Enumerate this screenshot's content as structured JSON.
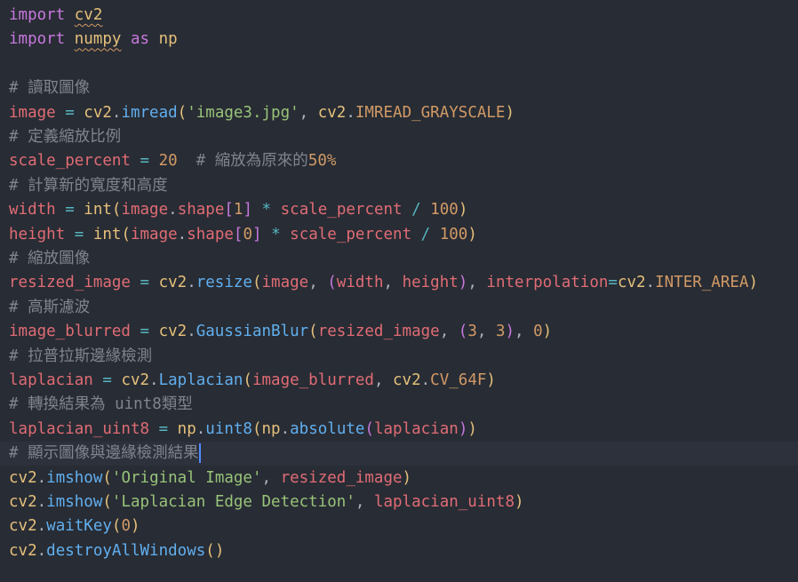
{
  "colors": {
    "background": "#282c34",
    "active_line": "#2c313c",
    "keyword": "#c678dd",
    "module": "#e5c07b",
    "variable": "#e06c75",
    "function": "#61afef",
    "string": "#98c379",
    "number": "#d19a66",
    "operator": "#56b6c2",
    "comment": "#7f848e",
    "punct": "#abb2bf",
    "cursor": "#528bff"
  },
  "editor": {
    "active_line_index": 18,
    "cursor_after_token": 0,
    "lines": [
      [
        {
          "t": "import",
          "c": "keyword"
        },
        {
          "t": " ",
          "c": "punct"
        },
        {
          "t": "cv2",
          "c": "module",
          "squiggle": true
        }
      ],
      [
        {
          "t": "import",
          "c": "keyword"
        },
        {
          "t": " ",
          "c": "punct"
        },
        {
          "t": "numpy",
          "c": "module",
          "squiggle": true
        },
        {
          "t": " as ",
          "c": "keyword"
        },
        {
          "t": "np",
          "c": "module"
        }
      ],
      [],
      [
        {
          "t": "# 讀取圖像",
          "c": "comment"
        }
      ],
      [
        {
          "t": "image",
          "c": "variable"
        },
        {
          "t": " = ",
          "c": "operator"
        },
        {
          "t": "cv2",
          "c": "module"
        },
        {
          "t": ".",
          "c": "punct"
        },
        {
          "t": "imread",
          "c": "function"
        },
        {
          "t": "(",
          "c": "module"
        },
        {
          "t": "'image3.jpg'",
          "c": "string"
        },
        {
          "t": ", ",
          "c": "punct"
        },
        {
          "t": "cv2",
          "c": "module"
        },
        {
          "t": ".",
          "c": "punct"
        },
        {
          "t": "IMREAD_GRAYSCALE",
          "c": "number"
        },
        {
          "t": ")",
          "c": "module"
        }
      ],
      [
        {
          "t": "# 定義縮放比例",
          "c": "comment"
        }
      ],
      [
        {
          "t": "scale_percent",
          "c": "variable"
        },
        {
          "t": " = ",
          "c": "operator"
        },
        {
          "t": "20",
          "c": "number"
        },
        {
          "t": "  # 縮放為原來的",
          "c": "comment"
        },
        {
          "t": "50%",
          "c": "number"
        }
      ],
      [
        {
          "t": "# 計算新的寬度和高度",
          "c": "comment"
        }
      ],
      [
        {
          "t": "width",
          "c": "variable"
        },
        {
          "t": " = ",
          "c": "operator"
        },
        {
          "t": "int",
          "c": "module"
        },
        {
          "t": "(",
          "c": "module"
        },
        {
          "t": "image",
          "c": "variable"
        },
        {
          "t": ".",
          "c": "punct"
        },
        {
          "t": "shape",
          "c": "variable"
        },
        {
          "t": "[",
          "c": "keyword"
        },
        {
          "t": "1",
          "c": "number"
        },
        {
          "t": "]",
          "c": "keyword"
        },
        {
          "t": " * ",
          "c": "operator"
        },
        {
          "t": "scale_percent",
          "c": "variable"
        },
        {
          "t": " / ",
          "c": "operator"
        },
        {
          "t": "100",
          "c": "number"
        },
        {
          "t": ")",
          "c": "module"
        }
      ],
      [
        {
          "t": "height",
          "c": "variable"
        },
        {
          "t": " = ",
          "c": "operator"
        },
        {
          "t": "int",
          "c": "module"
        },
        {
          "t": "(",
          "c": "module"
        },
        {
          "t": "image",
          "c": "variable"
        },
        {
          "t": ".",
          "c": "punct"
        },
        {
          "t": "shape",
          "c": "variable"
        },
        {
          "t": "[",
          "c": "keyword"
        },
        {
          "t": "0",
          "c": "number"
        },
        {
          "t": "]",
          "c": "keyword"
        },
        {
          "t": " * ",
          "c": "operator"
        },
        {
          "t": "scale_percent",
          "c": "variable"
        },
        {
          "t": " / ",
          "c": "operator"
        },
        {
          "t": "100",
          "c": "number"
        },
        {
          "t": ")",
          "c": "module"
        }
      ],
      [
        {
          "t": "# 縮放圖像",
          "c": "comment"
        }
      ],
      [
        {
          "t": "resized_image",
          "c": "variable"
        },
        {
          "t": " = ",
          "c": "operator"
        },
        {
          "t": "cv2",
          "c": "module"
        },
        {
          "t": ".",
          "c": "punct"
        },
        {
          "t": "resize",
          "c": "function"
        },
        {
          "t": "(",
          "c": "module"
        },
        {
          "t": "image",
          "c": "variable"
        },
        {
          "t": ", ",
          "c": "punct"
        },
        {
          "t": "(",
          "c": "keyword"
        },
        {
          "t": "width",
          "c": "variable"
        },
        {
          "t": ", ",
          "c": "punct"
        },
        {
          "t": "height",
          "c": "variable"
        },
        {
          "t": ")",
          "c": "keyword"
        },
        {
          "t": ", ",
          "c": "punct"
        },
        {
          "t": "interpolation",
          "c": "variable"
        },
        {
          "t": "=",
          "c": "operator"
        },
        {
          "t": "cv2",
          "c": "module"
        },
        {
          "t": ".",
          "c": "punct"
        },
        {
          "t": "INTER_AREA",
          "c": "number"
        },
        {
          "t": ")",
          "c": "module"
        }
      ],
      [
        {
          "t": "# 高斯濾波",
          "c": "comment"
        }
      ],
      [
        {
          "t": "image_blurred",
          "c": "variable"
        },
        {
          "t": " = ",
          "c": "operator"
        },
        {
          "t": "cv2",
          "c": "module"
        },
        {
          "t": ".",
          "c": "punct"
        },
        {
          "t": "GaussianBlur",
          "c": "function"
        },
        {
          "t": "(",
          "c": "module"
        },
        {
          "t": "resized_image",
          "c": "variable"
        },
        {
          "t": ", ",
          "c": "punct"
        },
        {
          "t": "(",
          "c": "keyword"
        },
        {
          "t": "3",
          "c": "number"
        },
        {
          "t": ", ",
          "c": "punct"
        },
        {
          "t": "3",
          "c": "number"
        },
        {
          "t": ")",
          "c": "keyword"
        },
        {
          "t": ", ",
          "c": "punct"
        },
        {
          "t": "0",
          "c": "number"
        },
        {
          "t": ")",
          "c": "module"
        }
      ],
      [
        {
          "t": "# 拉普拉斯邊緣檢測",
          "c": "comment"
        }
      ],
      [
        {
          "t": "laplacian",
          "c": "variable"
        },
        {
          "t": " = ",
          "c": "operator"
        },
        {
          "t": "cv2",
          "c": "module"
        },
        {
          "t": ".",
          "c": "punct"
        },
        {
          "t": "Laplacian",
          "c": "function"
        },
        {
          "t": "(",
          "c": "module"
        },
        {
          "t": "image_blurred",
          "c": "variable"
        },
        {
          "t": ", ",
          "c": "punct"
        },
        {
          "t": "cv2",
          "c": "module"
        },
        {
          "t": ".",
          "c": "punct"
        },
        {
          "t": "CV_64F",
          "c": "number"
        },
        {
          "t": ")",
          "c": "module"
        }
      ],
      [
        {
          "t": "# 轉換結果為 uint8類型",
          "c": "comment"
        }
      ],
      [
        {
          "t": "laplacian_uint8",
          "c": "variable"
        },
        {
          "t": " = ",
          "c": "operator"
        },
        {
          "t": "np",
          "c": "module"
        },
        {
          "t": ".",
          "c": "punct"
        },
        {
          "t": "uint8",
          "c": "function"
        },
        {
          "t": "(",
          "c": "module"
        },
        {
          "t": "np",
          "c": "module"
        },
        {
          "t": ".",
          "c": "punct"
        },
        {
          "t": "absolute",
          "c": "function"
        },
        {
          "t": "(",
          "c": "keyword"
        },
        {
          "t": "laplacian",
          "c": "variable"
        },
        {
          "t": ")",
          "c": "keyword"
        },
        {
          "t": ")",
          "c": "module"
        }
      ],
      [
        {
          "t": "# 顯示圖像與邊緣檢測結果",
          "c": "comment"
        }
      ],
      [
        {
          "t": "cv2",
          "c": "module"
        },
        {
          "t": ".",
          "c": "punct"
        },
        {
          "t": "imshow",
          "c": "function"
        },
        {
          "t": "(",
          "c": "module"
        },
        {
          "t": "'Original Image'",
          "c": "string"
        },
        {
          "t": ", ",
          "c": "punct"
        },
        {
          "t": "resized_image",
          "c": "variable"
        },
        {
          "t": ")",
          "c": "module"
        }
      ],
      [
        {
          "t": "cv2",
          "c": "module"
        },
        {
          "t": ".",
          "c": "punct"
        },
        {
          "t": "imshow",
          "c": "function"
        },
        {
          "t": "(",
          "c": "module"
        },
        {
          "t": "'Laplacian Edge Detection'",
          "c": "string"
        },
        {
          "t": ", ",
          "c": "punct"
        },
        {
          "t": "laplacian_uint8",
          "c": "variable"
        },
        {
          "t": ")",
          "c": "module"
        }
      ],
      [
        {
          "t": "cv2",
          "c": "module"
        },
        {
          "t": ".",
          "c": "punct"
        },
        {
          "t": "waitKey",
          "c": "function"
        },
        {
          "t": "(",
          "c": "module"
        },
        {
          "t": "0",
          "c": "number"
        },
        {
          "t": ")",
          "c": "module"
        }
      ],
      [
        {
          "t": "cv2",
          "c": "module"
        },
        {
          "t": ".",
          "c": "punct"
        },
        {
          "t": "destroyAllWindows",
          "c": "function"
        },
        {
          "t": "()",
          "c": "module"
        }
      ]
    ]
  }
}
